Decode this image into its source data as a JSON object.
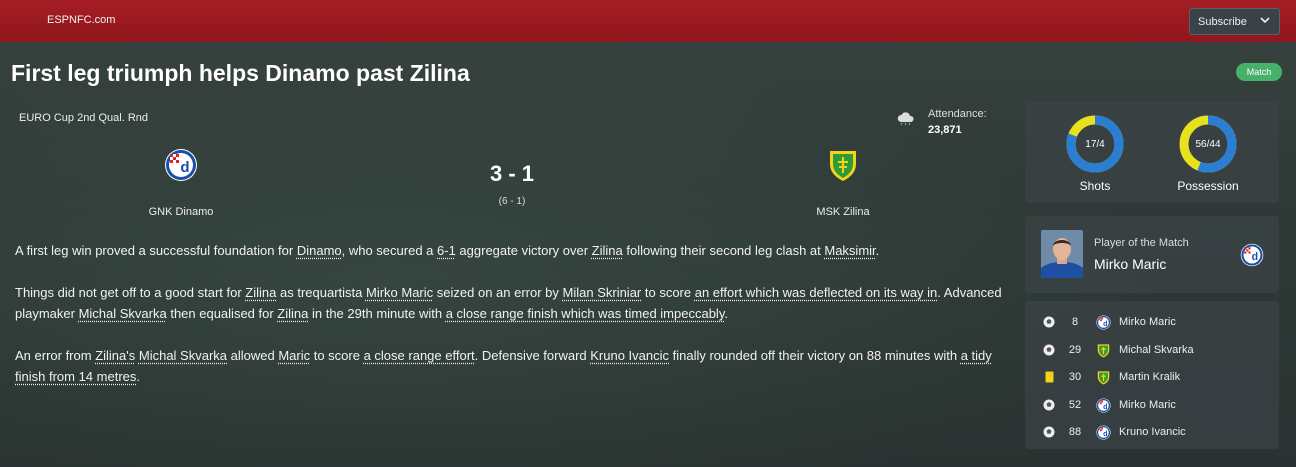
{
  "site": {
    "brand": "ESPNFC.com",
    "subscribe_label": "Subscribe",
    "subscribe_icon": "chevron-down-icon"
  },
  "article": {
    "headline": "First leg triumph helps Dinamo past Zilina",
    "tag": "Match",
    "tag_color": "#47b06a"
  },
  "match": {
    "competition": "EURO Cup 2nd Qual. Rnd",
    "weather_icon": "cloud-icon",
    "attendance_label": "Attendance:",
    "attendance_value": "23,871",
    "home": {
      "name": "GNK Dinamo",
      "crest": "dinamo-crest-icon",
      "color": "#1a4fa8"
    },
    "away": {
      "name": "MSK Zilina",
      "crest": "zilina-crest-icon",
      "color": "#2f9a3a"
    },
    "score": "3 - 1",
    "aggregate": "(6 - 1)"
  },
  "story": {
    "p1": [
      {
        "t": "A first leg win proved a successful foundation for "
      },
      {
        "t": "Dinamo",
        "link": true
      },
      {
        "t": ", who secured a "
      },
      {
        "t": "6-1",
        "link": true
      },
      {
        "t": " aggregate victory over "
      },
      {
        "t": "Zilina",
        "link": true
      },
      {
        "t": " following their second leg clash at "
      },
      {
        "t": "Maksimir",
        "link": true
      },
      {
        "t": "."
      }
    ],
    "p2": [
      {
        "t": "Things did not get off to a good start for "
      },
      {
        "t": "Zilina",
        "link": true
      },
      {
        "t": " as trequartista "
      },
      {
        "t": "Mirko Maric",
        "link": true
      },
      {
        "t": " seized on an error by "
      },
      {
        "t": "Milan Skriniar",
        "link": true
      },
      {
        "t": " to score "
      },
      {
        "t": "an effort which was deflected on its way in",
        "link": true
      },
      {
        "t": ". Advanced playmaker "
      },
      {
        "t": "Michal Skvarka",
        "link": true
      },
      {
        "t": " then equalised for "
      },
      {
        "t": "Zilina",
        "link": true
      },
      {
        "t": " in the 29th minute with "
      },
      {
        "t": "a close range finish which was timed impeccably",
        "link": true
      },
      {
        "t": "."
      }
    ],
    "p3": [
      {
        "t": "An error from "
      },
      {
        "t": "Zilina's",
        "link": true
      },
      {
        "t": " "
      },
      {
        "t": "Michal Skvarka",
        "link": true
      },
      {
        "t": " allowed "
      },
      {
        "t": "Maric",
        "link": true
      },
      {
        "t": " to score "
      },
      {
        "t": "a close range effort",
        "link": true
      },
      {
        "t": ". Defensive forward "
      },
      {
        "t": "Kruno Ivancic",
        "link": true
      },
      {
        "t": " finally rounded off their victory on 88 minutes with "
      },
      {
        "t": "a tidy finish from 14 metres",
        "link": true
      },
      {
        "t": "."
      }
    ]
  },
  "stats": {
    "shots": {
      "label": "Shots",
      "text": "17/4",
      "home": 17,
      "away": 4
    },
    "possession": {
      "label": "Possession",
      "text": "56/44",
      "home": 56,
      "away": 44
    },
    "home_color": "#2a7fd4",
    "away_color": "#e8e21c"
  },
  "potm": {
    "label": "Player of the Match",
    "name": "Mirko Maric",
    "crest": "dinamo-crest-icon"
  },
  "events": [
    {
      "icon": "ball-icon",
      "minute": "8",
      "team": "home",
      "player": "Mirko Maric"
    },
    {
      "icon": "ball-icon",
      "minute": "29",
      "team": "away",
      "player": "Michal Skvarka"
    },
    {
      "icon": "yellow-card-icon",
      "minute": "30",
      "team": "away",
      "player": "Martin Kralik"
    },
    {
      "icon": "ball-icon",
      "minute": "52",
      "team": "home",
      "player": "Mirko Maric"
    },
    {
      "icon": "ball-icon",
      "minute": "88",
      "team": "home",
      "player": "Kruno Ivancic"
    }
  ]
}
